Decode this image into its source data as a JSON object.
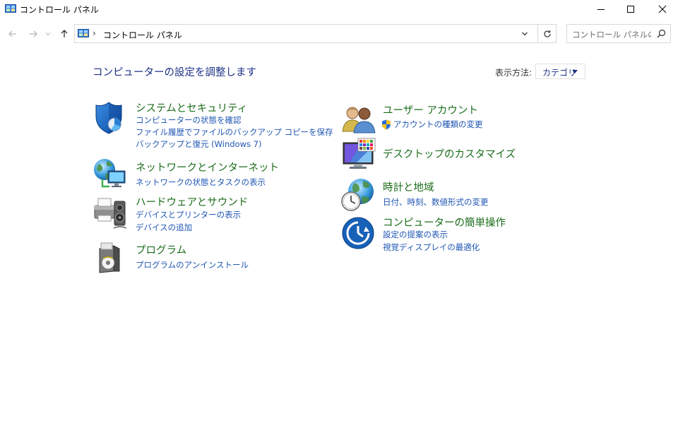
{
  "window": {
    "title": "コントロール パネル"
  },
  "address": {
    "separator": "›",
    "path": "コントロール パネル",
    "search_placeholder": "コントロール パネルの..."
  },
  "main": {
    "title": "コンピューターの設定を調整します",
    "view_by_label": "表示方法:",
    "view_by_value": "カテゴリ"
  },
  "categories": {
    "system_security": {
      "title": "システムとセキュリティ",
      "links": [
        "コンピューターの状態を確認",
        "ファイル履歴でファイルのバックアップ コピーを保存",
        "バックアップと復元 (Windows 7)"
      ]
    },
    "network": {
      "title": "ネットワークとインターネット",
      "links": [
        "ネットワークの状態とタスクの表示"
      ]
    },
    "hardware": {
      "title": "ハードウェアとサウンド",
      "links": [
        "デバイスとプリンターの表示",
        "デバイスの追加"
      ]
    },
    "programs": {
      "title": "プログラム",
      "links": [
        "プログラムのアンインストール"
      ]
    },
    "user_accounts": {
      "title": "ユーザー アカウント",
      "links": [
        "アカウントの種類の変更"
      ]
    },
    "personalization": {
      "title": "デスクトップのカスタマイズ",
      "links": []
    },
    "clock_region": {
      "title": "時計と地域",
      "links": [
        "日付、時刻、数値形式の変更"
      ]
    },
    "ease_of_access": {
      "title": "コンピューターの簡単操作",
      "links": [
        "設定の提案の表示",
        "視覚ディスプレイの最適化"
      ]
    }
  },
  "colors": {
    "category_title": "#1b6d1b",
    "link": "#1f56b4",
    "heading": "#1e3287"
  }
}
